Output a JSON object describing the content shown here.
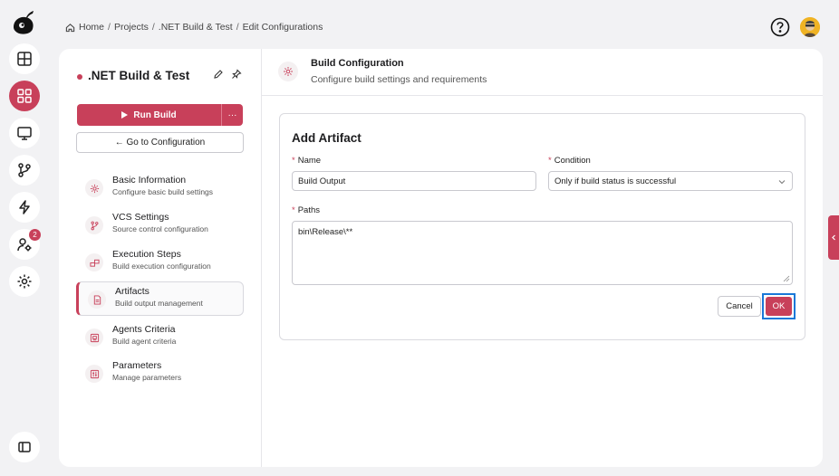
{
  "breadcrumb": {
    "home": "Home",
    "projects": "Projects",
    "project": ".NET Build & Test",
    "current": "Edit Configurations",
    "separator": "/"
  },
  "rail": {
    "items": [
      "dashboard-icon",
      "apps-icon",
      "monitor-icon",
      "branch-icon",
      "lightning-icon",
      "user-settings-icon",
      "gear-icon"
    ],
    "active_index": 1,
    "badge_count": "2",
    "bottom": "sidebar-toggle-icon"
  },
  "sidebar": {
    "project_title": ".NET Build & Test",
    "run_label": "Run Build",
    "more_label": "···",
    "goto_label": "← Go to Configuration",
    "items": [
      {
        "title": "Basic Information",
        "subtitle": "Configure basic build settings",
        "icon": "gear-icon"
      },
      {
        "title": "VCS Settings",
        "subtitle": "Source control configuration",
        "icon": "branch-icon"
      },
      {
        "title": "Execution Steps",
        "subtitle": "Build execution configuration",
        "icon": "steps-icon"
      },
      {
        "title": "Artifacts",
        "subtitle": "Build output management",
        "icon": "file-icon"
      },
      {
        "title": "Agents Criteria",
        "subtitle": "Build agent criteria",
        "icon": "agent-icon"
      },
      {
        "title": "Parameters",
        "subtitle": "Manage parameters",
        "icon": "parameters-icon"
      }
    ],
    "active_index": 3
  },
  "header": {
    "title": "Build Configuration",
    "subtitle": "Configure build settings and requirements"
  },
  "form": {
    "title": "Add Artifact",
    "name_label": "Name",
    "name_value": "Build Output",
    "condition_label": "Condition",
    "condition_value": "Only if build status is successful",
    "paths_label": "Paths",
    "paths_value": "bin\\Release\\**",
    "required_mark": "*",
    "cancel_label": "Cancel",
    "ok_label": "OK"
  },
  "colors": {
    "accent": "#c8405a",
    "focus_ring": "#1a78d8"
  }
}
